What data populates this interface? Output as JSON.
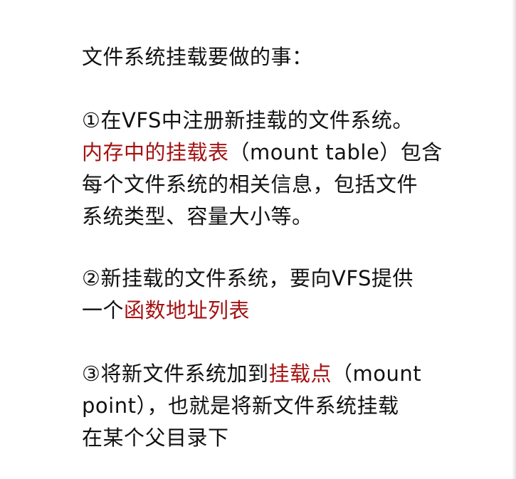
{
  "colors": {
    "text": "#111111",
    "highlight": "#a31212",
    "background": "#ffffff"
  },
  "doc": {
    "heading": "文件系统挂载要做的事：",
    "s1": {
      "l1": "①在VFS中注册新挂载的文件系统。",
      "l2_red": "内存中的挂载表",
      "l2_rest": "（mount table）包含",
      "l3": "每个文件系统的相关信息，包括文件",
      "l4": "系统类型、容量大小等。"
    },
    "s2": {
      "l1": "②新挂载的文件系统，要向VFS提供",
      "l2_pre": "一个",
      "l2_red": "函数地址列表"
    },
    "s3": {
      "l1_pre": "③将新文件系统加到",
      "l1_red": "挂载点",
      "l1_rest": "（mount",
      "l2": "point），也就是将新文件系统挂载",
      "l3": "在某个父目录下"
    }
  }
}
